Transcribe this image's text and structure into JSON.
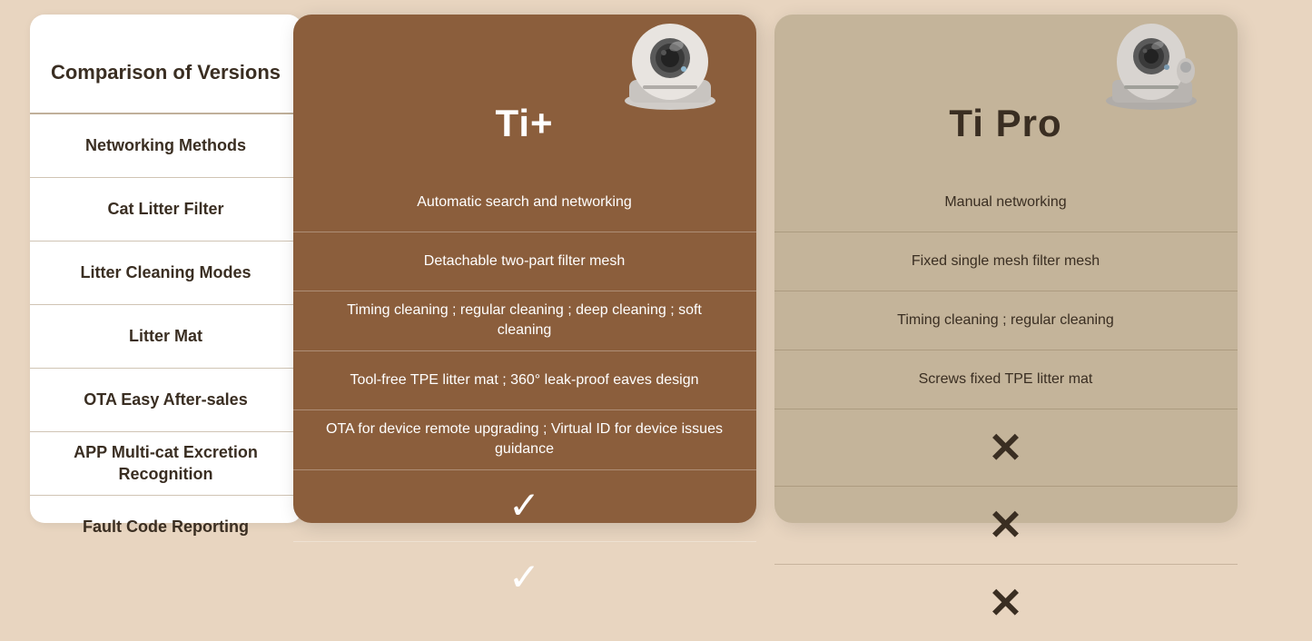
{
  "sidebar": {
    "title": "Comparison of Versions",
    "items": [
      {
        "label": "Comparison of Versions"
      },
      {
        "label": "Networking Methods"
      },
      {
        "label": "Cat Litter Filter"
      },
      {
        "label": "Litter Cleaning Modes"
      },
      {
        "label": "Litter Mat"
      },
      {
        "label": "OTA Easy After-sales"
      },
      {
        "label": "APP Multi-cat Excretion Recognition"
      },
      {
        "label": "Fault Code Reporting"
      }
    ]
  },
  "tiplus": {
    "title": "Ti+",
    "rows": [
      {
        "text": "Automatic search and networking",
        "type": "text"
      },
      {
        "text": "Detachable two-part filter mesh",
        "type": "text"
      },
      {
        "text": "Timing cleaning ; regular cleaning ; deep cleaning ; soft cleaning",
        "type": "text"
      },
      {
        "text": "Tool-free TPE litter mat ; 360° leak-proof eaves design",
        "type": "text"
      },
      {
        "text": "OTA for device remote upgrading ; Virtual ID for device issues guidance",
        "type": "text"
      },
      {
        "text": "✓",
        "type": "check"
      },
      {
        "text": "✓",
        "type": "check"
      }
    ]
  },
  "tipro": {
    "title": "Ti Pro",
    "rows": [
      {
        "text": "Manual networking",
        "type": "text"
      },
      {
        "text": "Fixed single mesh filter mesh",
        "type": "text"
      },
      {
        "text": "Timing cleaning ; regular cleaning",
        "type": "text"
      },
      {
        "text": "Screws fixed TPE litter mat",
        "type": "text"
      },
      {
        "text": "",
        "type": "cross"
      },
      {
        "text": "",
        "type": "cross"
      },
      {
        "text": "",
        "type": "cross"
      }
    ]
  },
  "colors": {
    "tiplus_bg": "#8B5E3C",
    "tipro_bg": "#c4b49a",
    "sidebar_bg": "#ffffff",
    "body_bg": "#e8d5c0"
  }
}
